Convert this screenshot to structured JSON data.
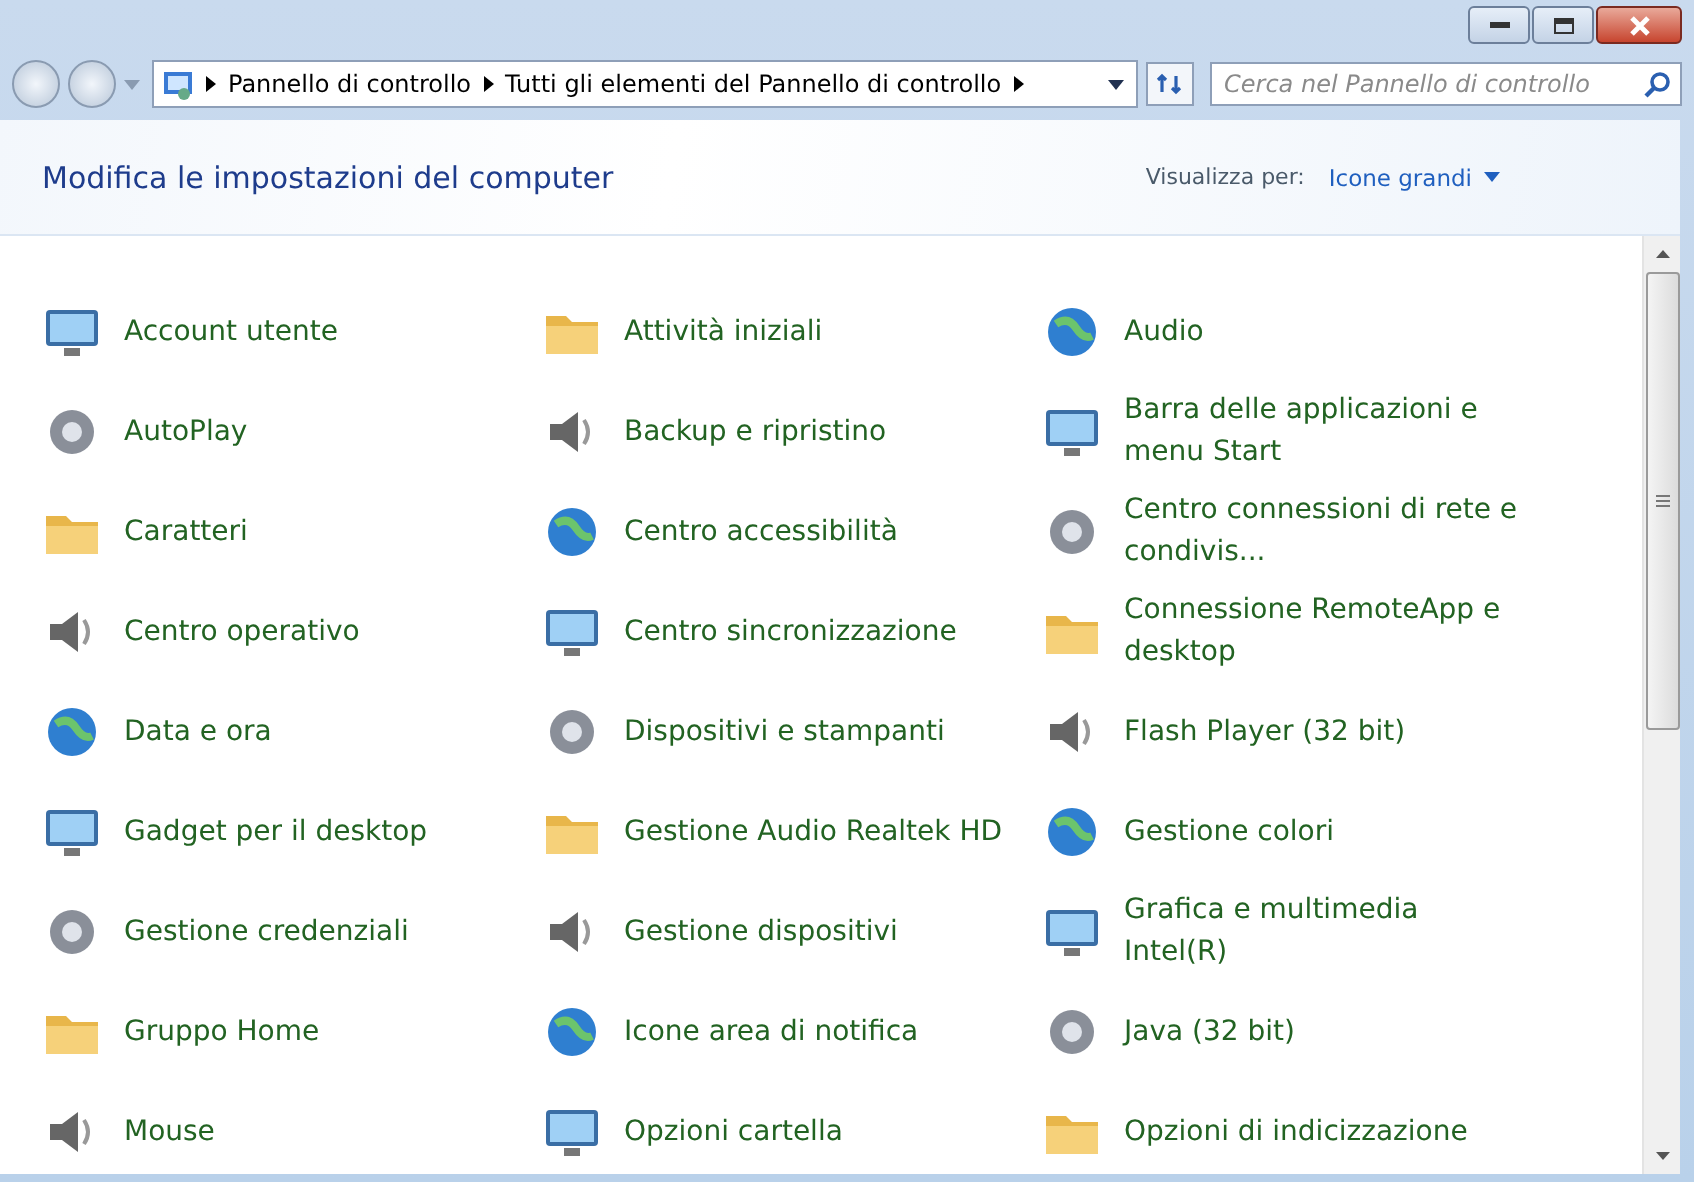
{
  "window": {
    "breadcrumb": [
      {
        "label": "Pannello di controllo"
      },
      {
        "label": "Tutti gli elementi del Pannello di controllo"
      }
    ],
    "search": {
      "placeholder": "Cerca nel Pannello di controllo"
    }
  },
  "header": {
    "title": "Modifica le impostazioni del computer",
    "view_label": "Visualizza per:",
    "view_value": "Icone grandi"
  },
  "rows": [
    {
      "items": [
        {
          "label": "Account utente"
        },
        {
          "label": "Attività iniziali"
        },
        {
          "label": "Audio"
        }
      ]
    },
    {
      "items": [
        {
          "label": "AutoPlay"
        },
        {
          "label": "Backup e ripristino"
        },
        {
          "label": "Barra delle applicazioni e menu Start"
        }
      ]
    },
    {
      "items": [
        {
          "label": "Caratteri"
        },
        {
          "label": "Centro accessibilità"
        },
        {
          "label": "Centro connessioni di rete e condivis..."
        }
      ]
    },
    {
      "items": [
        {
          "label": "Centro operativo"
        },
        {
          "label": "Centro sincronizzazione"
        },
        {
          "label": "Connessione RemoteApp e desktop"
        }
      ]
    },
    {
      "items": [
        {
          "label": "Data e ora"
        },
        {
          "label": "Dispositivi e stampanti"
        },
        {
          "label": "Flash Player (32 bit)"
        }
      ]
    },
    {
      "items": [
        {
          "label": "Gadget per il desktop"
        },
        {
          "label": "Gestione Audio Realtek HD"
        },
        {
          "label": "Gestione colori"
        }
      ]
    },
    {
      "items": [
        {
          "label": "Gestione credenziali"
        },
        {
          "label": "Gestione dispositivi"
        },
        {
          "label": "Grafica e multimedia Intel(R)"
        }
      ]
    },
    {
      "items": [
        {
          "label": "Gruppo Home"
        },
        {
          "label": "Icone area di notifica"
        },
        {
          "label": "Java (32 bit)"
        }
      ]
    },
    {
      "items": [
        {
          "label": "Mouse"
        },
        {
          "label": "Opzioni cartella"
        },
        {
          "label": "Opzioni di indicizzazione"
        }
      ]
    }
  ]
}
